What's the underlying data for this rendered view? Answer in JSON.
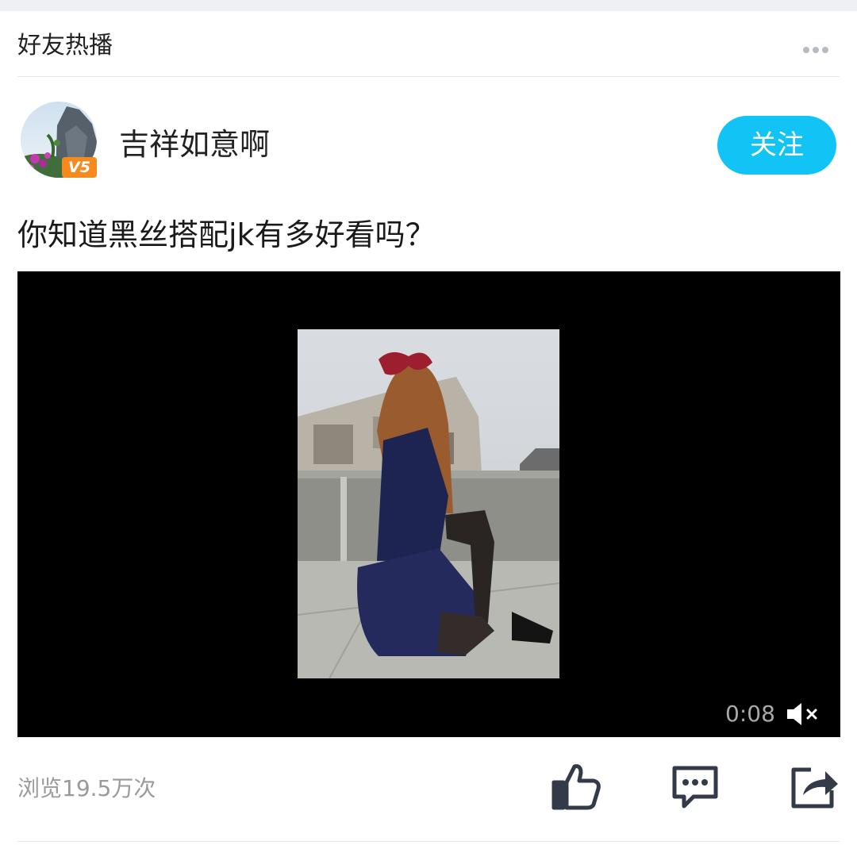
{
  "header": {
    "title": "好友热播",
    "more_icon": "more-dots-icon"
  },
  "post": {
    "author": {
      "name": "吉祥如意啊",
      "vip_badge": "V5"
    },
    "follow_label": "关注",
    "title": "你知道黑丝搭配jk有多好看吗？",
    "video": {
      "duration": "0:08",
      "muted": true
    },
    "views": "浏览19.5万次"
  },
  "actions": [
    "like-icon",
    "comment-icon",
    "share-icon"
  ],
  "colors": {
    "accent": "#12c4f5",
    "badge": "#f68a1e",
    "icon": "#333a48"
  }
}
